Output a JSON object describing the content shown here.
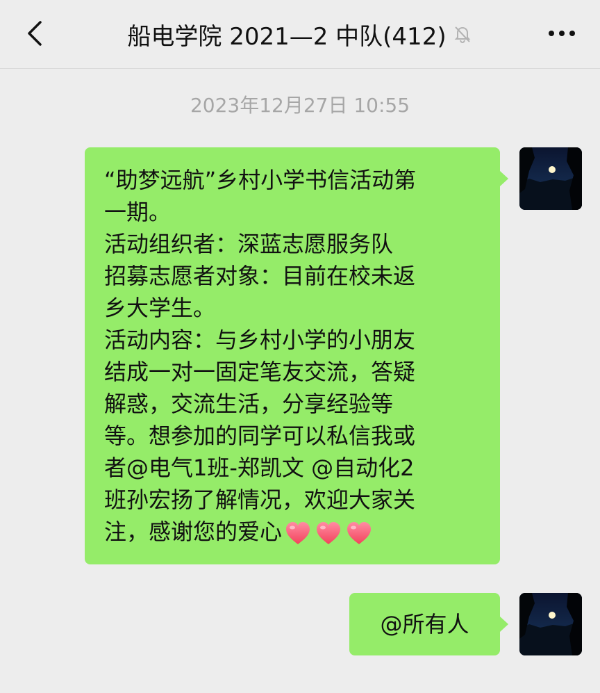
{
  "header": {
    "title": "船电学院 2021—2 中队(412)",
    "back_icon": "chevron-left-icon",
    "mute_icon": "bell-muted-icon",
    "more_icon": "more-dots-icon"
  },
  "chat": {
    "timestamp": "2023年12月27日 10:55",
    "messages": [
      {
        "sender": "self",
        "lines": [
          "“助梦远航”乡村小学书信活动第",
          "一期。",
          "活动组织者：深蓝志愿服务队",
          "招募志愿者对象：目前在校未返",
          "乡大学生。",
          "活动内容：与乡村小学的小朋友",
          "结成一对一固定笔友交流，答疑",
          "解惑，交流生活，分享经验等",
          "等。想参加的同学可以私信我或",
          "者@电气1班-郑凯文 @自动化2",
          "班孙宏扬了解情况，欢迎大家关",
          "注，感谢您的爱心"
        ],
        "emoji": [
          "heart-emoji",
          "heart-emoji",
          "heart-emoji"
        ]
      },
      {
        "sender": "self",
        "lines": [
          "@所有人"
        ]
      }
    ]
  },
  "colors": {
    "bubble": "#95ec69",
    "background": "#ededed",
    "timestamp": "#a6a6a6"
  }
}
